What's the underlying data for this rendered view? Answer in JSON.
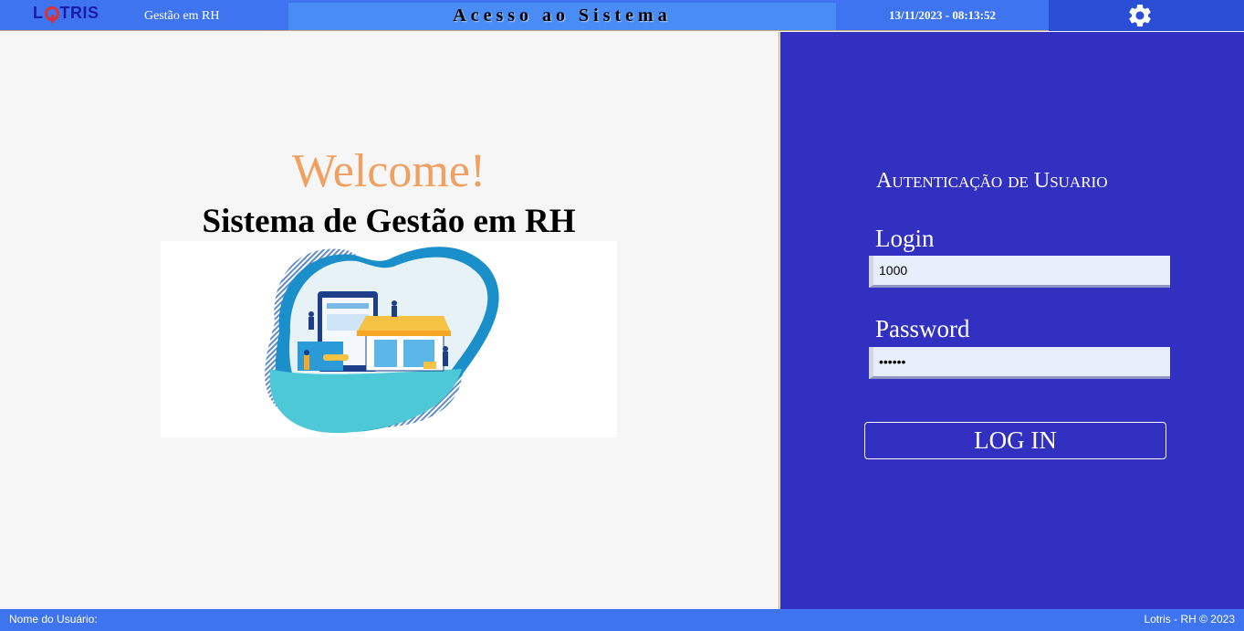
{
  "header": {
    "logo_text_left": "L",
    "logo_text_right": "TRIS",
    "app_name": "Gestão em RH",
    "page_title": "Acesso ao Sistema",
    "datetime": "13/11/2023 - 08:13:52",
    "settings_icon": "gear-icon"
  },
  "welcome": {
    "greeting": "Welcome!",
    "system_name": "Sistema de Gestão em RH",
    "illustration": "online-store-illustration"
  },
  "auth": {
    "title": "Autenticação de Usuario",
    "login_label": "Login",
    "login_value": "1000",
    "password_label": "Password",
    "password_value": "••••••",
    "login_button": "LOG IN"
  },
  "footer": {
    "user_label": "Nome do Usuário:",
    "copyright": "Lotris - RH © 2023"
  },
  "colors": {
    "top_bar": "#3f74f0",
    "title_band": "#4a8cf5",
    "gear_band": "#2a4fd6",
    "right_panel": "#3230c0",
    "welcome_text": "#f0a060",
    "logo": "#1a1aa6",
    "logo_accent": "#e03030"
  }
}
